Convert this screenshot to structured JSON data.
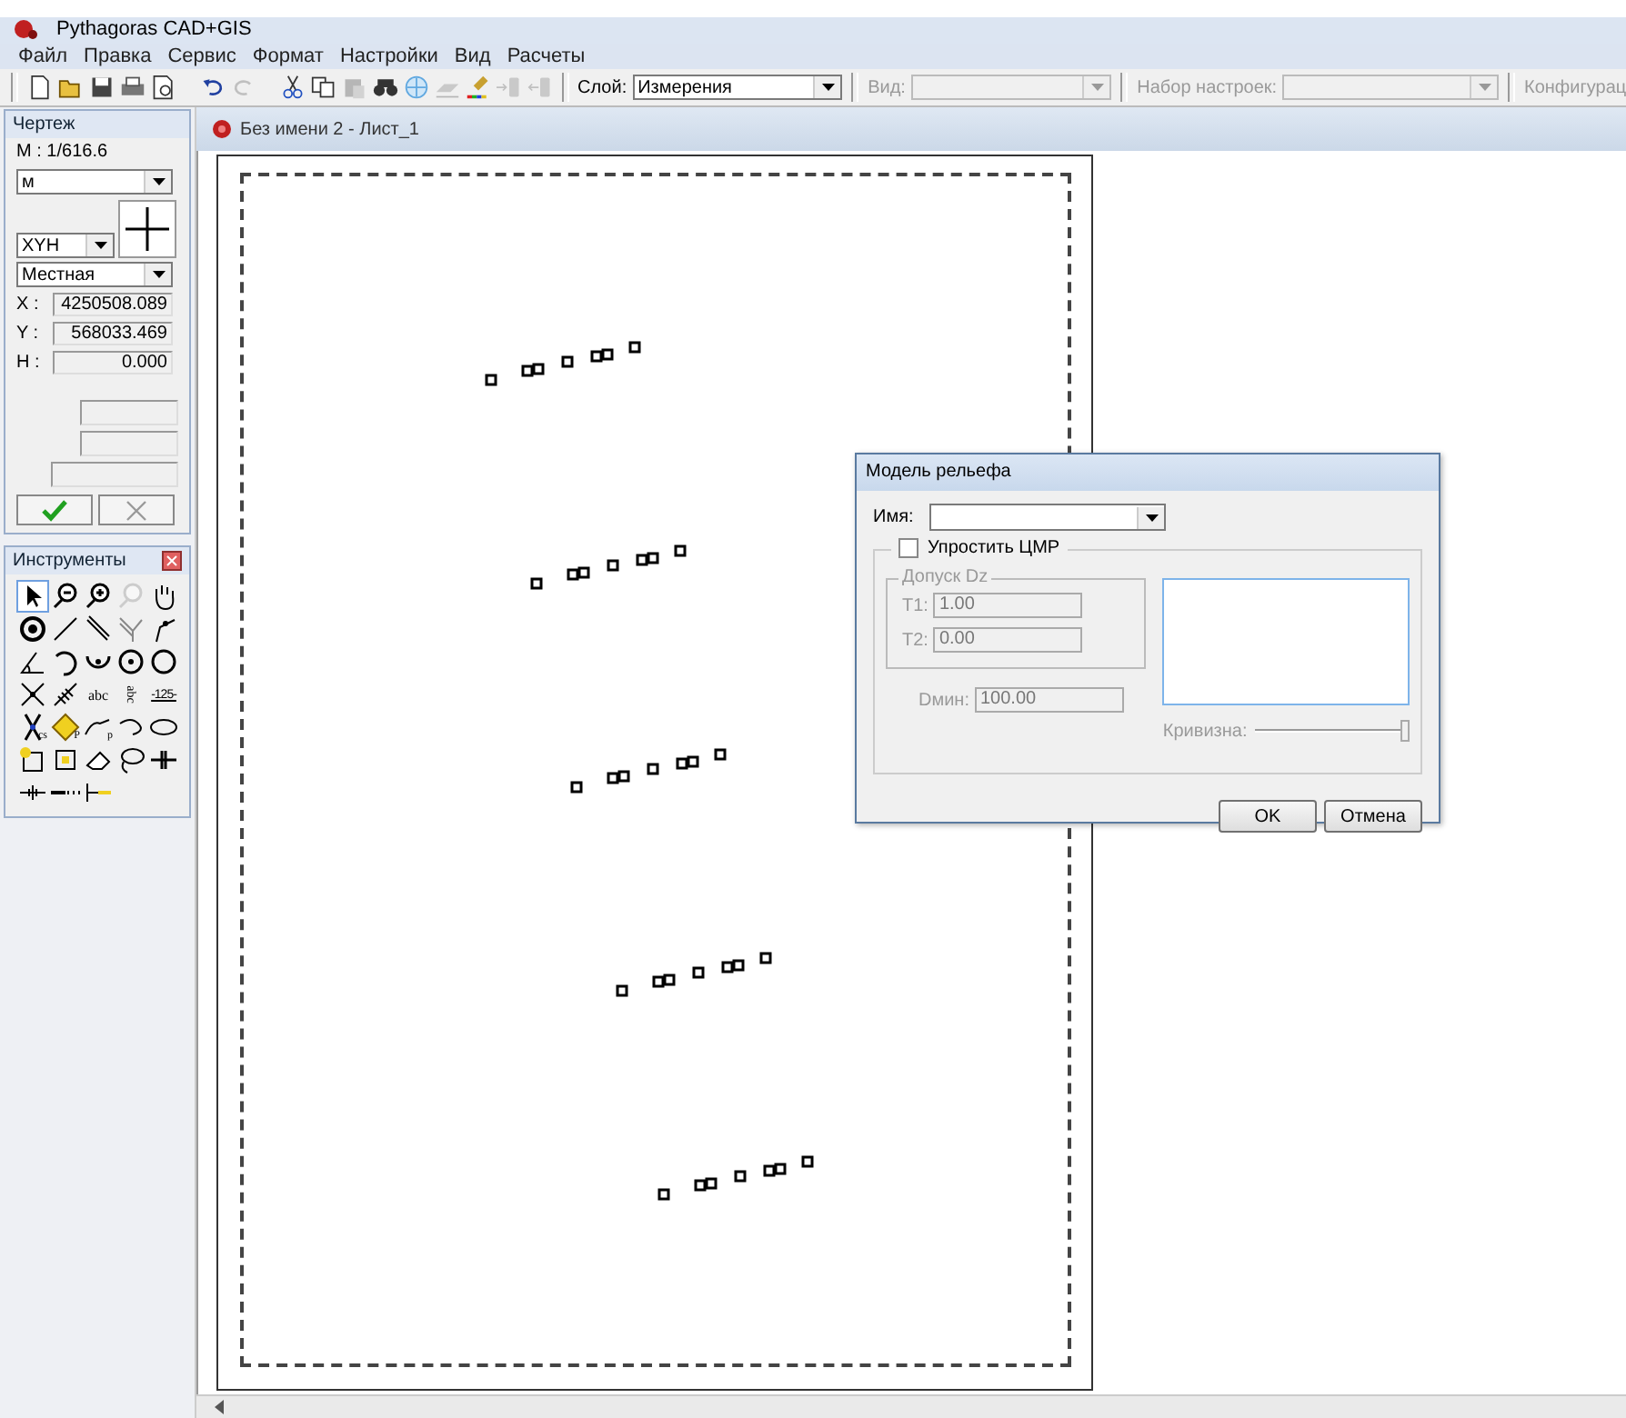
{
  "app": {
    "title": "Pythagoras CAD+GIS"
  },
  "menu": [
    "Файл",
    "Правка",
    "Сервис",
    "Формат",
    "Настройки",
    "Вид",
    "Расчеты"
  ],
  "toolbar": {
    "buttons": [
      {
        "disabled": false
      },
      {
        "disabled": false
      },
      {
        "disabled": false
      },
      {
        "disabled": false
      },
      {
        "disabled": false
      },
      {
        "disabled": false
      },
      {
        "disabled": true
      },
      {
        "disabled": false
      },
      {
        "disabled": false
      },
      {
        "disabled": true
      },
      {
        "disabled": false
      },
      {
        "disabled": false
      },
      {
        "disabled": true
      },
      {
        "disabled": false
      },
      {
        "disabled": true
      },
      {
        "disabled": true
      }
    ],
    "layer": {
      "label": "Слой:",
      "value": "Измерения",
      "disabled": false
    },
    "view": {
      "label": "Вид:",
      "disabled": true
    },
    "preset": {
      "label": "Набор настроек:",
      "disabled": true
    },
    "config": {
      "label": "Конфигурац"
    }
  },
  "drawing_panel": {
    "title": "Чертеж",
    "scale": "M : 1/616.6",
    "unit": "м",
    "axes": "XYH",
    "system": "Местная",
    "coords": [
      {
        "label": "X :",
        "value": "4250508.089"
      },
      {
        "label": "Y :",
        "value": "568033.469"
      },
      {
        "label": "H :",
        "value": "0.000"
      }
    ],
    "ok_disabled": false,
    "cancel_disabled": true
  },
  "tools_panel": {
    "title": "Инструменты",
    "items": [
      {
        "selected": true,
        "disabled": false
      },
      {
        "selected": false,
        "disabled": false
      },
      {
        "selected": false,
        "disabled": false
      },
      {
        "selected": false,
        "disabled": true
      },
      {
        "selected": false,
        "disabled": false
      },
      {
        "selected": false,
        "disabled": false
      },
      {
        "selected": false,
        "disabled": false
      },
      {
        "selected": false,
        "disabled": false
      },
      {
        "selected": false,
        "disabled": false
      },
      {
        "selected": false,
        "disabled": false
      },
      {
        "selected": false,
        "disabled": false
      },
      {
        "selected": false,
        "disabled": false
      },
      {
        "selected": false,
        "disabled": false
      },
      {
        "selected": false,
        "disabled": false
      },
      {
        "selected": false,
        "disabled": false
      },
      {
        "selected": false,
        "disabled": false
      },
      {
        "selected": false,
        "disabled": false
      },
      {
        "selected": false,
        "disabled": false,
        "label": "abc"
      },
      {
        "selected": false,
        "disabled": false,
        "label": "abc",
        "vertical": true
      },
      {
        "selected": false,
        "disabled": false,
        "label": "-125-"
      },
      {
        "selected": false,
        "disabled": false,
        "label": "cs"
      },
      {
        "selected": false,
        "disabled": false,
        "label": "P"
      },
      {
        "selected": false,
        "disabled": false,
        "label": "p"
      },
      {
        "selected": false,
        "disabled": false
      },
      {
        "selected": false,
        "disabled": false
      },
      {
        "selected": false,
        "disabled": false
      },
      {
        "selected": false,
        "disabled": false
      },
      {
        "selected": false,
        "disabled": false
      },
      {
        "selected": false,
        "disabled": false
      },
      {
        "selected": false,
        "disabled": false
      },
      {
        "selected": false,
        "disabled": false
      },
      {
        "selected": false,
        "disabled": false
      },
      {
        "selected": false,
        "disabled": false
      }
    ]
  },
  "document": {
    "title": "Без имени  2 - Лист_1"
  },
  "dialog": {
    "title": "Модель рельефа",
    "name_label": "Имя:",
    "simplify": {
      "label": "Упростить ЦМР",
      "checked": false
    },
    "tolerance": {
      "title": "Допуск Dz",
      "fields": [
        {
          "label": "T1:",
          "value": "1.00"
        },
        {
          "label": "T2:",
          "value": "0.00"
        }
      ]
    },
    "dmin": {
      "label": "Dмин:",
      "value": "100.00"
    },
    "curvature": {
      "label": "Кривизна:",
      "level": 1
    },
    "buttons": [
      {
        "label": "OK"
      },
      {
        "label": "Отмена"
      }
    ]
  }
}
